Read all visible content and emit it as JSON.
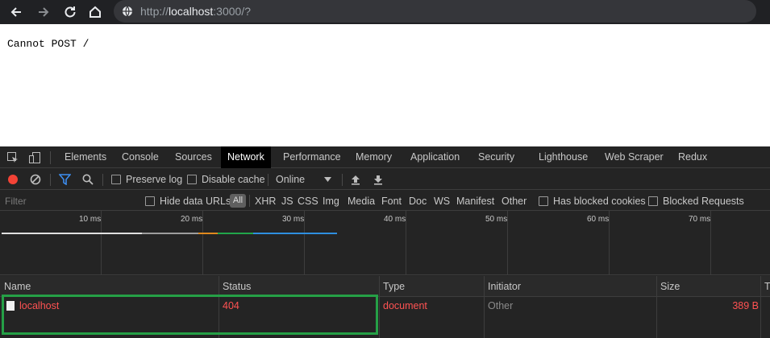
{
  "browser": {
    "url_prefix": "http://",
    "url_host": "localhost",
    "url_suffix": ":3000/?",
    "icons": [
      "back-icon",
      "forward-icon",
      "reload-icon",
      "home-icon",
      "globe-icon"
    ]
  },
  "page": {
    "body_text": "Cannot POST /"
  },
  "devtools": {
    "tabs": [
      "Elements",
      "Console",
      "Sources",
      "Network",
      "Performance",
      "Memory",
      "Application",
      "Security",
      "Lighthouse",
      "Web Scraper",
      "Redux"
    ],
    "active_tab": "Network",
    "toolbar": {
      "preserve_log": "Preserve log",
      "disable_cache": "Disable cache",
      "throttling": "Online"
    },
    "filter": {
      "placeholder": "Filter",
      "hide_data_urls": "Hide data URLs",
      "all": "All",
      "types": [
        "XHR",
        "JS",
        "CSS",
        "Img",
        "Media",
        "Font",
        "Doc",
        "WS",
        "Manifest",
        "Other"
      ],
      "has_blocked_cookies": "Has blocked cookies",
      "blocked_requests": "Blocked Requests"
    },
    "timeline_ticks": [
      "10 ms",
      "20 ms",
      "30 ms",
      "40 ms",
      "50 ms",
      "60 ms",
      "70 ms"
    ],
    "columns": [
      "Name",
      "Status",
      "Type",
      "Initiator",
      "Size",
      "T"
    ],
    "rows": [
      {
        "name": "localhost",
        "status": "404",
        "type": "document",
        "initiator": "Other",
        "size": "389 B"
      }
    ],
    "colors": {
      "error_text": "#ff5252",
      "highlight_border": "#25a046",
      "record_button": "#f44336",
      "active_tab_bg": "#000000"
    }
  }
}
